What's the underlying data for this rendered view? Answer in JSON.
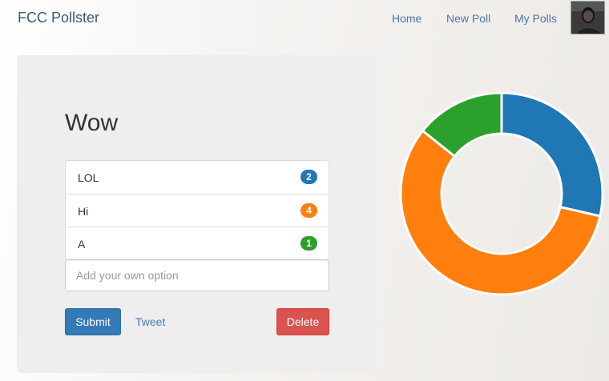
{
  "navbar": {
    "brand": "FCC Pollster",
    "links": [
      "Home",
      "New Poll",
      "My Polls"
    ]
  },
  "poll": {
    "title": "Wow",
    "options": [
      {
        "label": "LOL",
        "votes": "2",
        "color": "#1f77b4"
      },
      {
        "label": "Hi",
        "votes": "4",
        "color": "#ff7f0e"
      },
      {
        "label": "A",
        "votes": "1",
        "color": "#2ca02c"
      }
    ],
    "new_option_placeholder": "Add your own option",
    "submit_label": "Submit",
    "tweet_label": "Tweet",
    "delete_label": "Delete"
  },
  "chart_data": {
    "type": "pie",
    "categories": [
      "LOL",
      "Hi",
      "A"
    ],
    "values": [
      2,
      4,
      1
    ],
    "colors": [
      "#1f77b4",
      "#ff7f0e",
      "#2ca02c"
    ],
    "donut": true
  }
}
